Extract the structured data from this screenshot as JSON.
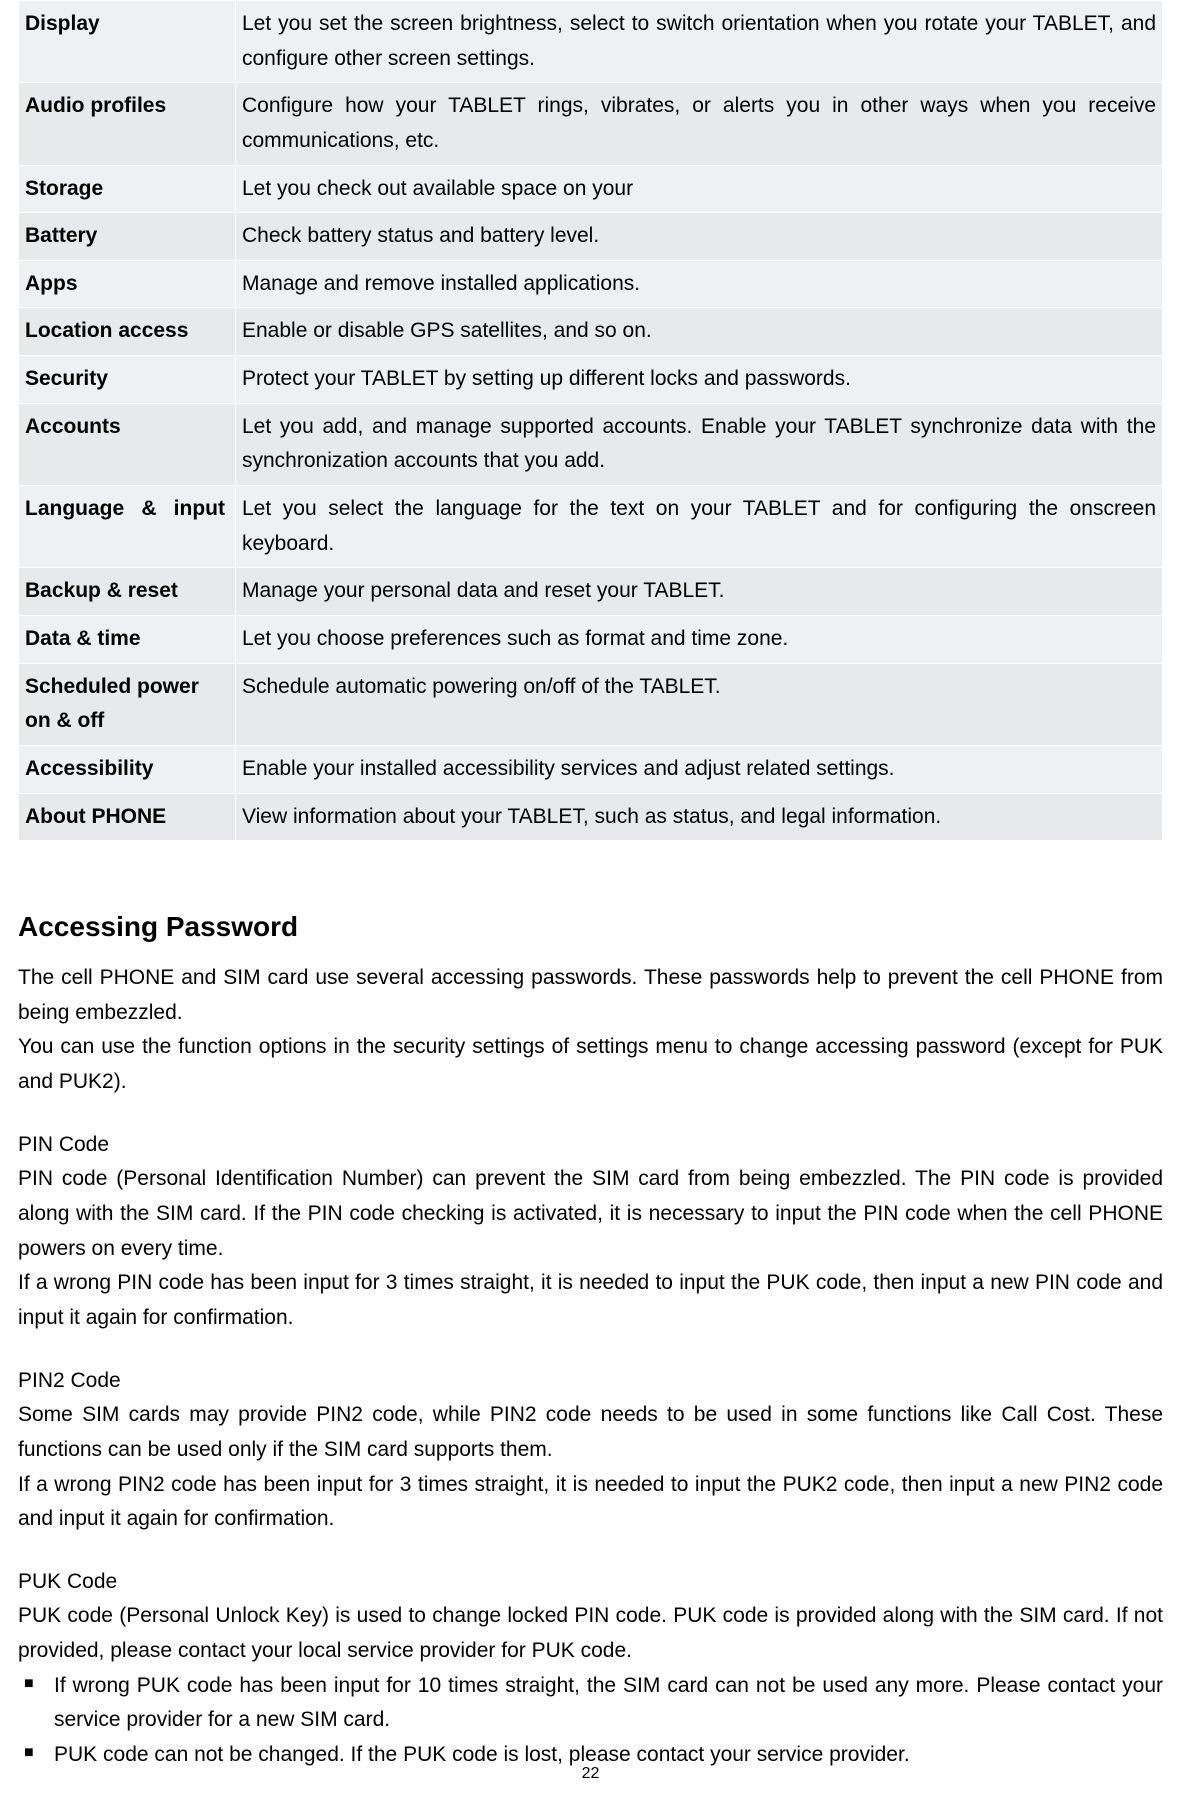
{
  "settings_table": [
    {
      "name": "Display",
      "desc": "Let you set the screen brightness, select to switch orientation when you rotate your TABLET, and configure other screen settings.",
      "justify": false
    },
    {
      "name": "Audio profiles",
      "desc": "Configure how your TABLET rings, vibrates, or alerts you in other ways when you receive communications, etc.",
      "justify": false
    },
    {
      "name": "Storage",
      "desc": "Let you check out available space on your",
      "justify": false
    },
    {
      "name": "Battery",
      "desc": "Check battery status and battery level.",
      "justify": false
    },
    {
      "name": "Apps",
      "desc": "Manage and remove installed applications.",
      "justify": false
    },
    {
      "name": "Location access",
      "desc": "Enable or disable GPS satellites, and so on.",
      "justify": false
    },
    {
      "name": "Security",
      "desc": "Protect your TABLET by setting up different locks and passwords.",
      "justify": false
    },
    {
      "name": "Accounts",
      "desc": "Let you add, and manage supported accounts. Enable your TABLET synchronize data with the synchronization accounts that you add.",
      "justify": false
    },
    {
      "name": "Language & input",
      "desc": "Let you select the language for the text on your TABLET and for configuring the onscreen keyboard.",
      "justify": true
    },
    {
      "name": "Backup & reset",
      "desc": "Manage your personal data and reset your TABLET.",
      "justify": false
    },
    {
      "name": "Data & time",
      "desc": "Let you choose preferences such as format and time zone.",
      "justify": false
    },
    {
      "name": "Scheduled power on & off",
      "desc": "Schedule automatic powering on/off of the TABLET.",
      "justify": false
    },
    {
      "name": "Accessibility",
      "desc": "Enable your installed accessibility services and adjust related settings.",
      "justify": false
    },
    {
      "name": "About PHONE",
      "desc": "View information about your TABLET, such as status, and legal information.",
      "justify": false
    }
  ],
  "section_heading": "Accessing Password",
  "intro": {
    "p1": "The cell PHONE and SIM card use several accessing passwords. These passwords help to prevent the cell PHONE from being embezzled.",
    "p2": "You can use the function options in the security settings of settings menu to change accessing password (except for PUK and PUK2)."
  },
  "pin": {
    "title": "PIN Code",
    "p1": "PIN code (Personal Identification Number) can prevent the SIM card from being embezzled. The PIN code is provided along with the SIM card. If the PIN code checking is activated, it is necessary to input the PIN code when the cell PHONE powers on every time.",
    "p2": "If a wrong PIN code has been input for 3 times straight, it is needed to input the PUK code, then input a new PIN code and input it again for confirmation."
  },
  "pin2": {
    "title": "PIN2 Code",
    "p1": "Some SIM cards may provide PIN2 code, while PIN2 code needs to be used in some functions like Call Cost. These functions can be used only if the SIM card supports them.",
    "p2": "If a wrong PIN2 code has been input for 3 times straight, it is needed to input the PUK2 code, then input a new PIN2 code and input it again for confirmation."
  },
  "puk": {
    "title": "PUK Code",
    "p1": "PUK code (Personal Unlock Key) is used to change locked PIN code. PUK code is provided along with the SIM card. If not provided, please contact your local service provider for PUK code.",
    "bullets": [
      "If wrong PUK code has been input for 10 times straight, the SIM card can not be used any more. Please contact your service provider for a new SIM card.",
      "PUK code can not be changed. If the PUK code is lost, please contact your service provider."
    ]
  },
  "page_number": "22"
}
